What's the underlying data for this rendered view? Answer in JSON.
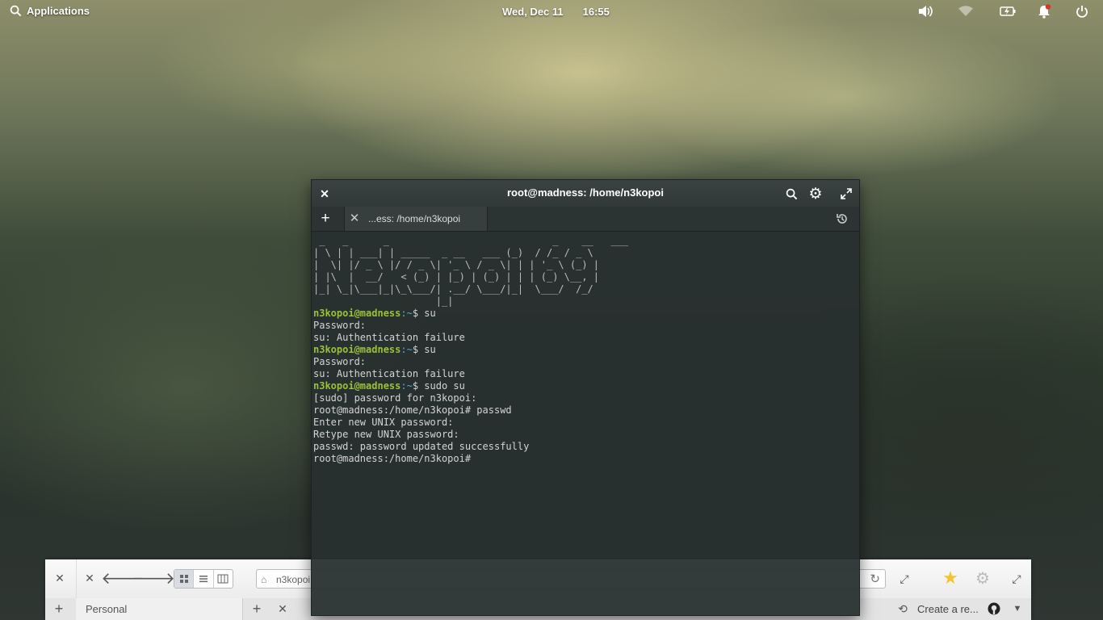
{
  "topbar": {
    "applications_label": "Applications",
    "date": "Wed, Dec 11",
    "time": "16:55"
  },
  "tray_icons": [
    "volume-icon",
    "wifi-icon",
    "battery-icon",
    "notification-bell-icon",
    "power-icon"
  ],
  "terminal": {
    "title": "root@madness: /home/n3kopoi",
    "tab_label": "...ess: /home/n3kopoi",
    "ascii_art": [
      " _   _      _                            _    __   ___ ",
      "| \\ | | ___| | _____  _ __   ___ (_)  / /_ / _ \\ ",
      "|  \\| |/ _ \\ |/ / _ \\| '_ \\ / _ \\| | | '_ \\ (_) |",
      "| |\\  |  __/   < (_) | |_) | (_) | | | (_) \\__, |",
      "|_| \\_|\\___|_|\\_\\___/| .__/ \\___/|_|  \\___/  /_/ ",
      "                     |_|"
    ],
    "lines": [
      {
        "kind": "prompt",
        "user": "n3kopoi@madness",
        "path": ":~",
        "cmd": "$ su"
      },
      {
        "kind": "out",
        "text": "Password:"
      },
      {
        "kind": "out",
        "text": "su: Authentication failure"
      },
      {
        "kind": "prompt",
        "user": "n3kopoi@madness",
        "path": ":~",
        "cmd": "$ su"
      },
      {
        "kind": "out",
        "text": "Password:"
      },
      {
        "kind": "out",
        "text": "su: Authentication failure"
      },
      {
        "kind": "prompt",
        "user": "n3kopoi@madness",
        "path": ":~",
        "cmd": "$ sudo su"
      },
      {
        "kind": "out",
        "text": "[sudo] password for n3kopoi:"
      },
      {
        "kind": "out",
        "text": "root@madness:/home/n3kopoi# passwd"
      },
      {
        "kind": "out",
        "text": "Enter new UNIX password:"
      },
      {
        "kind": "out",
        "text": "Retype new UNIX password:"
      },
      {
        "kind": "out",
        "text": "passwd: password updated successfully"
      },
      {
        "kind": "out",
        "text": "root@madness:/home/n3kopoi#"
      }
    ]
  },
  "file_manager": {
    "address": "n3kopoi",
    "sidebar_tab": "Personal",
    "right_tab": "Create a re..."
  },
  "colors": {
    "prompt_user": "#9bc03a",
    "prompt_path": "#52a7d3",
    "terminal_bg": "#283030"
  }
}
